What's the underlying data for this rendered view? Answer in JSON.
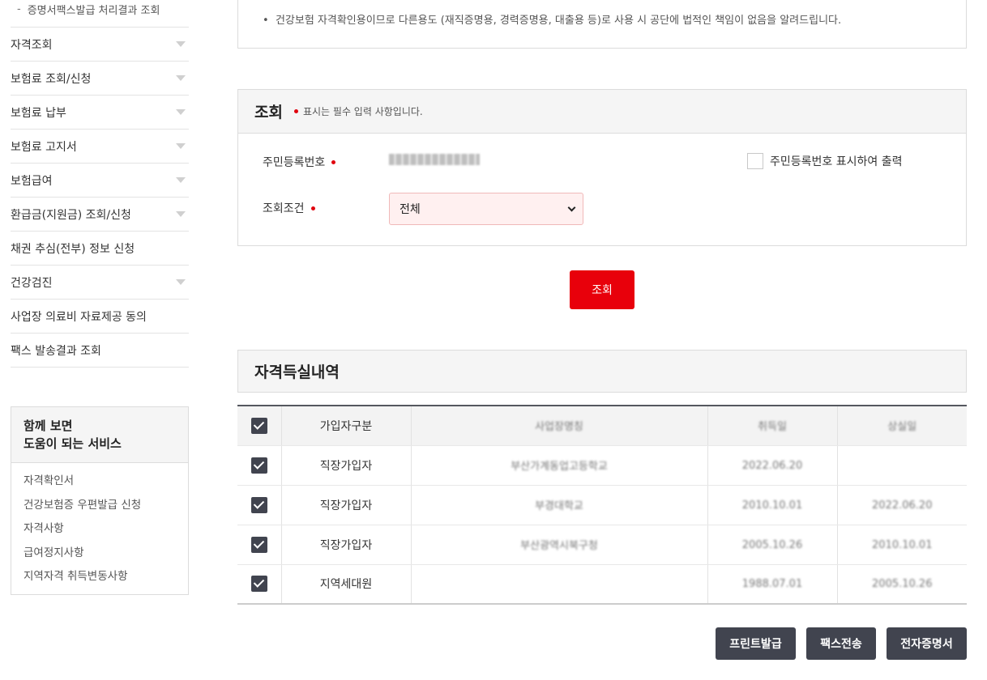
{
  "sidebar": {
    "sub_item": "증명서팩스발급 처리결과 조회",
    "items": [
      {
        "label": "자격조회",
        "has_sub": true
      },
      {
        "label": "보험료 조회/신청",
        "has_sub": true
      },
      {
        "label": "보험료 납부",
        "has_sub": true
      },
      {
        "label": "보험료 고지서",
        "has_sub": true
      },
      {
        "label": "보험급여",
        "has_sub": true
      },
      {
        "label": "환급금(지원금) 조회/신청",
        "has_sub": true
      },
      {
        "label": "채권 추심(전부) 정보 신청",
        "has_sub": false
      },
      {
        "label": "건강검진",
        "has_sub": true
      },
      {
        "label": "사업장 의료비 자료제공 동의",
        "has_sub": false
      },
      {
        "label": "팩스 발송결과 조회",
        "has_sub": false
      }
    ],
    "related": {
      "title_line1": "함께 보면",
      "title_line2": "도움이 되는 서비스",
      "links": [
        "자격확인서",
        "건강보험증 우편발급 신청",
        "자격사항",
        "급여정지사항",
        "지역자격 취득변동사항"
      ]
    }
  },
  "notice": {
    "bullet": "건강보험 자격확인용이므로 다른용도 (재직증명용, 경력증명용, 대출용 등)로 사용 시 공단에 법적인 책임이 없음을 알려드립니다."
  },
  "search": {
    "title": "조회",
    "required_note": "표시는 필수 입력 사항입니다.",
    "rrn_label": "주민등록번호",
    "show_rrn_label": "주민등록번호 표시하여 출력",
    "condition_label": "조회조건",
    "condition_value": "전체",
    "button": "조회"
  },
  "history": {
    "title": "자격득실내역",
    "columns": [
      "가입자구분",
      "사업장명칭",
      "취득일",
      "상실일"
    ],
    "rows": [
      {
        "type": "직장가입자",
        "workplace": "부산가계동업고등학교",
        "acquired": "2022.06.20",
        "lost": ""
      },
      {
        "type": "직장가입자",
        "workplace": "부경대학교",
        "acquired": "2010.10.01",
        "lost": "2022.06.20"
      },
      {
        "type": "직장가입자",
        "workplace": "부산광역시북구청",
        "acquired": "2005.10.26",
        "lost": "2010.10.01"
      },
      {
        "type": "지역세대원",
        "workplace": "",
        "acquired": "1988.07.01",
        "lost": "2005.10.26"
      }
    ]
  },
  "actions": {
    "print": "프린트발급",
    "fax": "팩스전송",
    "ecert": "전자증명서"
  },
  "colors": {
    "accent_red": "#e8000b",
    "dark_button": "#41444f",
    "select_bg": "#fff0f0"
  }
}
